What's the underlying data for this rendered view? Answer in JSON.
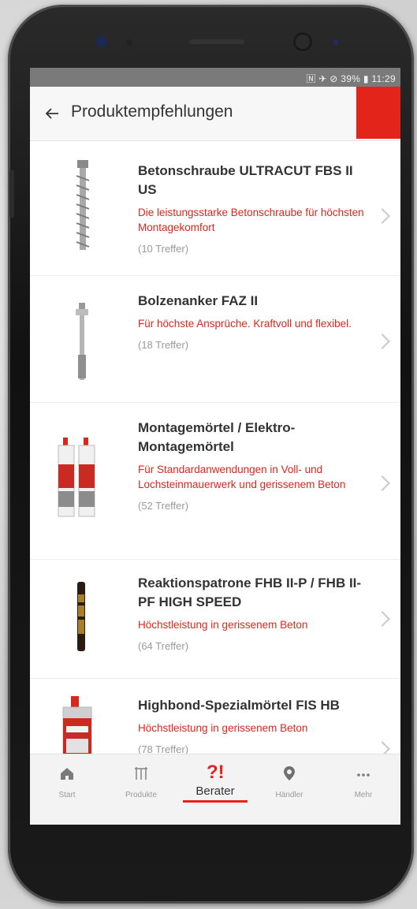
{
  "status_bar": {
    "text": "🄽 ✈ ⊘ 39% ▮ 11:29"
  },
  "app_bar": {
    "title": "Produktempfehlungen"
  },
  "products": [
    {
      "name": "Betonschraube ULTRACUT FBS II US",
      "description": "Die leistungsstarke Betonschraube für höchsten Montagekomfort",
      "hits": "(10 Treffer)"
    },
    {
      "name": "Bolzenanker FAZ II",
      "description": "Für höchste Ansprüche. Kraftvoll und flexibel.",
      "hits": "(18 Treffer)"
    },
    {
      "name": "Montagemörtel / Elektro-Montagemörtel",
      "description": "Für Standardanwendungen in Voll- und Lochsteinmauerwerk und gerissenem Beton",
      "hits": "(52 Treffer)"
    },
    {
      "name": "Reaktionspatrone FHB II-P / FHB II-PF HIGH SPEED",
      "description": "Höchstleistung in gerissenem Beton",
      "hits": "(64 Treffer)"
    },
    {
      "name": "Highbond-Spezialmörtel FIS HB",
      "description": "Höchstleistung in gerissenem Beton",
      "hits": "(78 Treffer)"
    }
  ],
  "bottom_nav": {
    "items": [
      {
        "label": "Start",
        "icon": "home-icon"
      },
      {
        "label": "Produkte",
        "icon": "products-icon"
      },
      {
        "label": "Berater",
        "icon": "advisor-icon",
        "active": true
      },
      {
        "label": "Händler",
        "icon": "location-pin-icon"
      },
      {
        "label": "Mehr",
        "icon": "more-dots-icon"
      }
    ]
  },
  "colors": {
    "accent": "#e2241a",
    "text": "#333333",
    "description": "#d9281e",
    "muted": "#9a9a9a"
  }
}
